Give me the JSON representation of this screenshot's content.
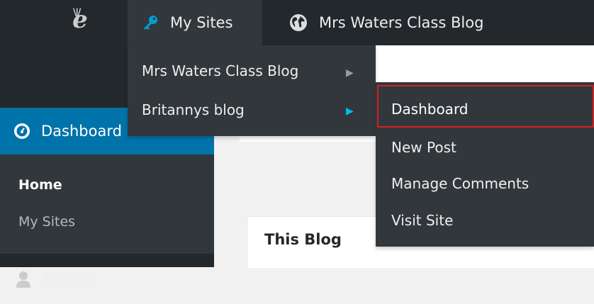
{
  "admin_bar": {
    "logo_icon": "edublogs-logo-icon",
    "logo_text": "e",
    "my_sites_label": "My Sites",
    "my_sites_icon": "key-icon",
    "current_blog_label": "Mrs Waters Class Blog",
    "current_blog_icon": "globe-icon",
    "accent_color": "#00a0d2"
  },
  "my_sites_menu": {
    "items": [
      {
        "label": "Mrs Waters Class Blog"
      },
      {
        "label": "Britannys blog"
      }
    ]
  },
  "blog_submenu": {
    "items": [
      {
        "label": "Dashboard"
      },
      {
        "label": "New Post"
      },
      {
        "label": "Manage Comments"
      },
      {
        "label": "Visit Site"
      }
    ],
    "highlight_color": "#d22222"
  },
  "sidebar": {
    "dashboard_label": "Dashboard",
    "dashboard_icon": "dashboard-gauge-icon",
    "home_label": "Home",
    "my_sites_label": "My Sites",
    "profile_label": "Profile",
    "profile_icon": "user-icon",
    "active_color": "#0073aa"
  },
  "content": {
    "box_title": "This Blog"
  }
}
